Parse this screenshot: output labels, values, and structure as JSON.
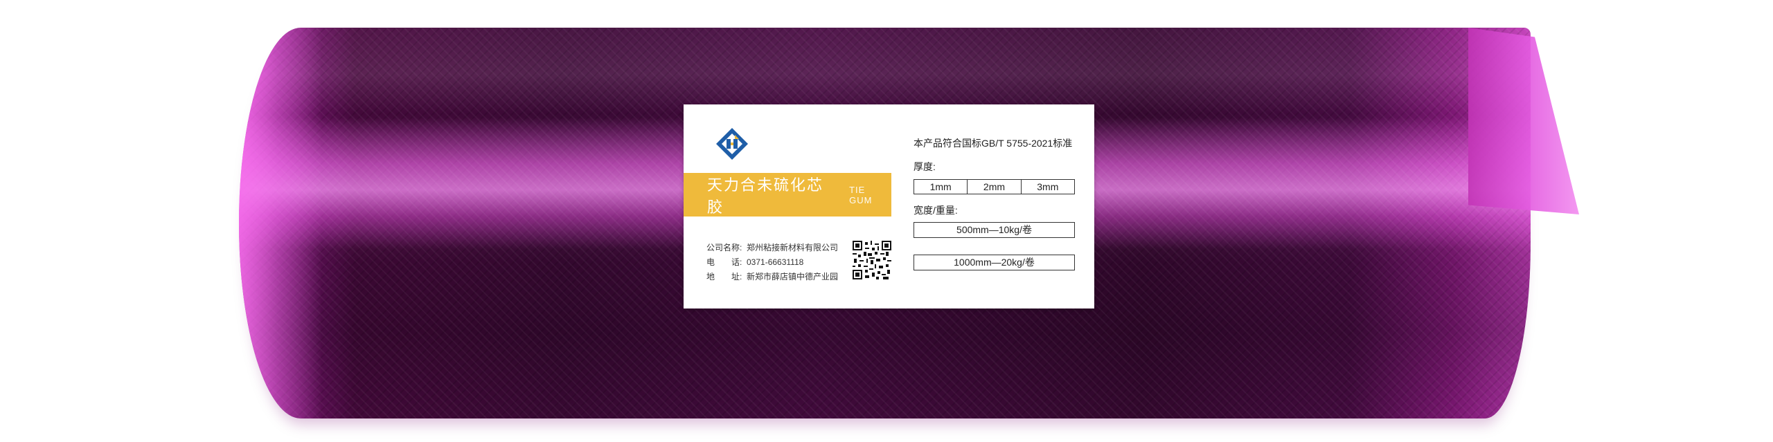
{
  "product": {
    "roll_color": "#8a1a80",
    "label": {
      "logo_icon": "diamond-logo-icon",
      "brand": {
        "name_cn": "天力合未硫化芯胶",
        "name_en": "TIE GUM",
        "bar_color": "#efba3b"
      },
      "company": {
        "rows": [
          {
            "key": "公司名称:",
            "value": "郑州粘接新材料有限公司"
          },
          {
            "key": "电　　话:",
            "value": "0371-66631118"
          },
          {
            "key": "地　　址:",
            "value": "新郑市薛店镇中德产业园"
          }
        ],
        "qr_icon": "qr-code-icon"
      },
      "specs": {
        "standard": "本产品符合国标GB/T 5755-2021标准",
        "thickness_label": "厚度:",
        "thickness_options": [
          "1mm",
          "2mm",
          "3mm"
        ],
        "width_weight_label": "宽度/重量:",
        "width_weight_options": [
          "500mm—10kg/卷",
          "1000mm—20kg/卷"
        ]
      }
    }
  }
}
